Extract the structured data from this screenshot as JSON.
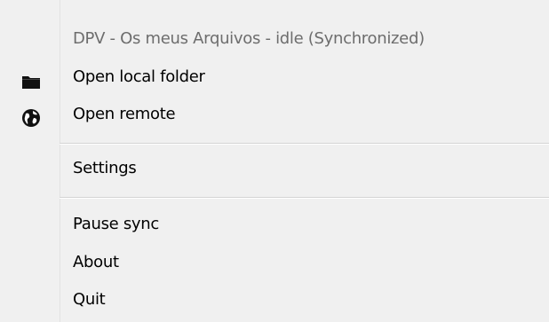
{
  "menu": {
    "status": {
      "label": "DPV - Os meus Arquivos - idle (Synchronized)"
    },
    "open_local": {
      "label": "Open local folder",
      "icon": "folder-icon"
    },
    "open_remote": {
      "label": "Open remote",
      "icon": "globe-icon"
    },
    "settings": {
      "label": "Settings"
    },
    "pause_sync": {
      "label": "Pause sync"
    },
    "about": {
      "label": "About"
    },
    "quit": {
      "label": "Quit"
    }
  }
}
